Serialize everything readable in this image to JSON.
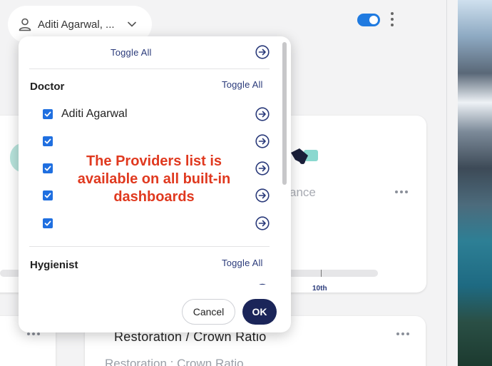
{
  "header": {
    "provider_selector": "Aditi Agarwal, ..."
  },
  "background": {
    "faded_word": "ance",
    "progress_tick_label": "10th",
    "card_title": "Restoration / Crown Ratio",
    "card_subtitle": "Restoration : Crown Ratio"
  },
  "panel": {
    "toggle_all_top": "Toggle All",
    "sections": [
      {
        "title": "Doctor",
        "toggle_all": "Toggle All",
        "providers": [
          {
            "label": "Aditi Agarwal",
            "checked": true
          },
          {
            "label": "",
            "checked": true
          },
          {
            "label": "",
            "checked": true
          },
          {
            "label": "",
            "checked": true
          },
          {
            "label": "",
            "checked": true
          }
        ]
      },
      {
        "title": "Hygienist",
        "toggle_all": "Toggle All",
        "providers": []
      }
    ],
    "annotation": "The Providers list is available on all built-in dashboards",
    "cancel_label": "Cancel",
    "ok_label": "OK"
  },
  "colors": {
    "accent": "#1f6fe0",
    "navy": "#1b2559",
    "link": "#2a3a7a",
    "annotation": "#e0391f"
  },
  "icons": {
    "person": "person-icon",
    "chevron": "chevron-down-icon",
    "go": "arrow-right-circle-icon",
    "handshake": "handshake-icon",
    "more": "more-options-icon"
  }
}
